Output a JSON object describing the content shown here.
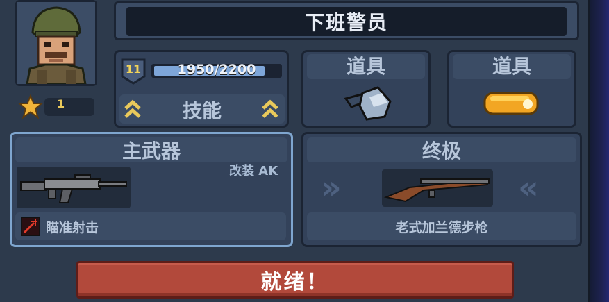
{
  "character": {
    "name": "下班警员",
    "star_count": "1",
    "level": "11",
    "xp_text": "1950/2200",
    "xp_fraction": 0.886
  },
  "skill": {
    "label": "技能"
  },
  "items": [
    {
      "title": "道具",
      "icon": "grenade-icon"
    },
    {
      "title": "道具",
      "icon": "gold-bar-icon"
    }
  ],
  "primary_weapon": {
    "title": "主武器",
    "mod_label": "改装 AK",
    "perk_label": "瞄准射击"
  },
  "ultimate": {
    "title": "终极",
    "weapon_name": "老式加兰德步枪"
  },
  "ready_button": {
    "label": "就绪！"
  }
}
